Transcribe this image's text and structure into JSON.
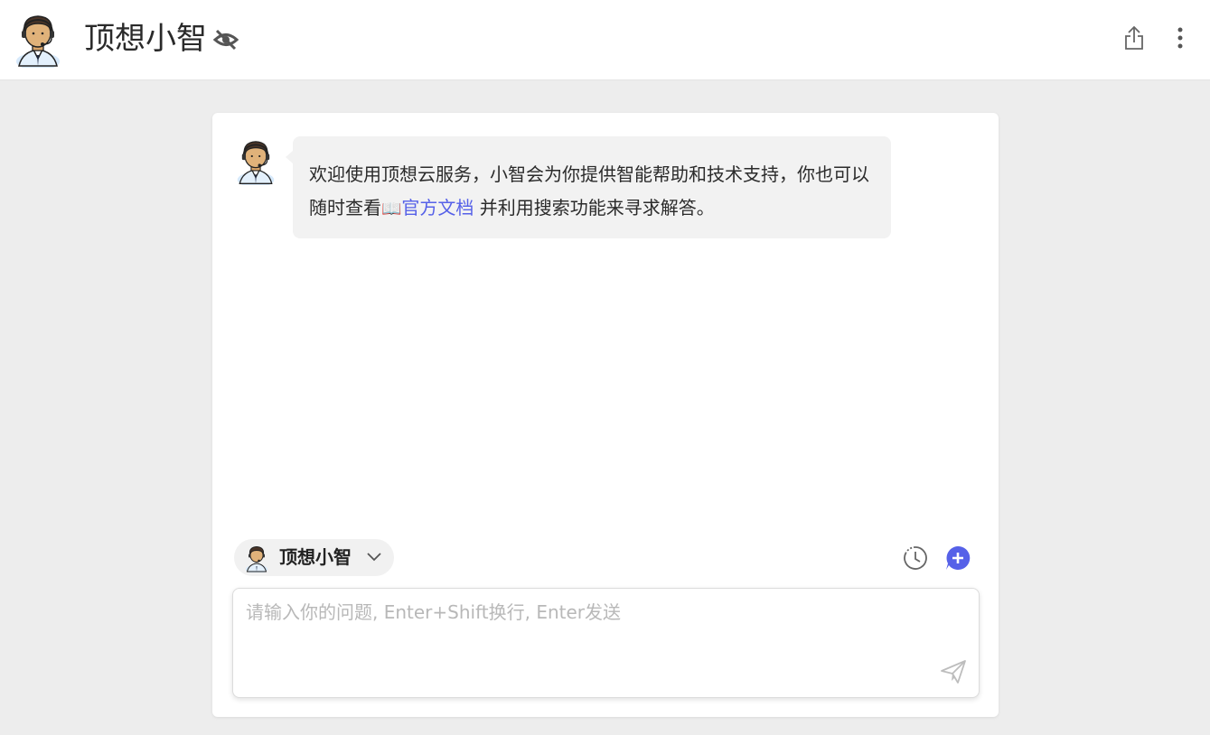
{
  "header": {
    "title": "顶想小智",
    "icons": [
      "agent-avatar",
      "eye-off-icon",
      "share-icon",
      "more-vertical-icon"
    ]
  },
  "chat": {
    "welcome": {
      "text_before": "欢迎使用顶想云服务，小智会为你提供智能帮助和技术支持，你也可以随时查看",
      "book_glyph": "📖",
      "link_text": "官方文档",
      "text_after": " 并利用搜索功能来寻求解答。"
    }
  },
  "composer": {
    "agent_name": "顶想小智",
    "placeholder": "请输入你的问题, Enter+Shift换行, Enter发送",
    "value": ""
  },
  "colors": {
    "accent": "#5661e8",
    "background": "#ededed",
    "bubble": "#f2f2f2"
  }
}
